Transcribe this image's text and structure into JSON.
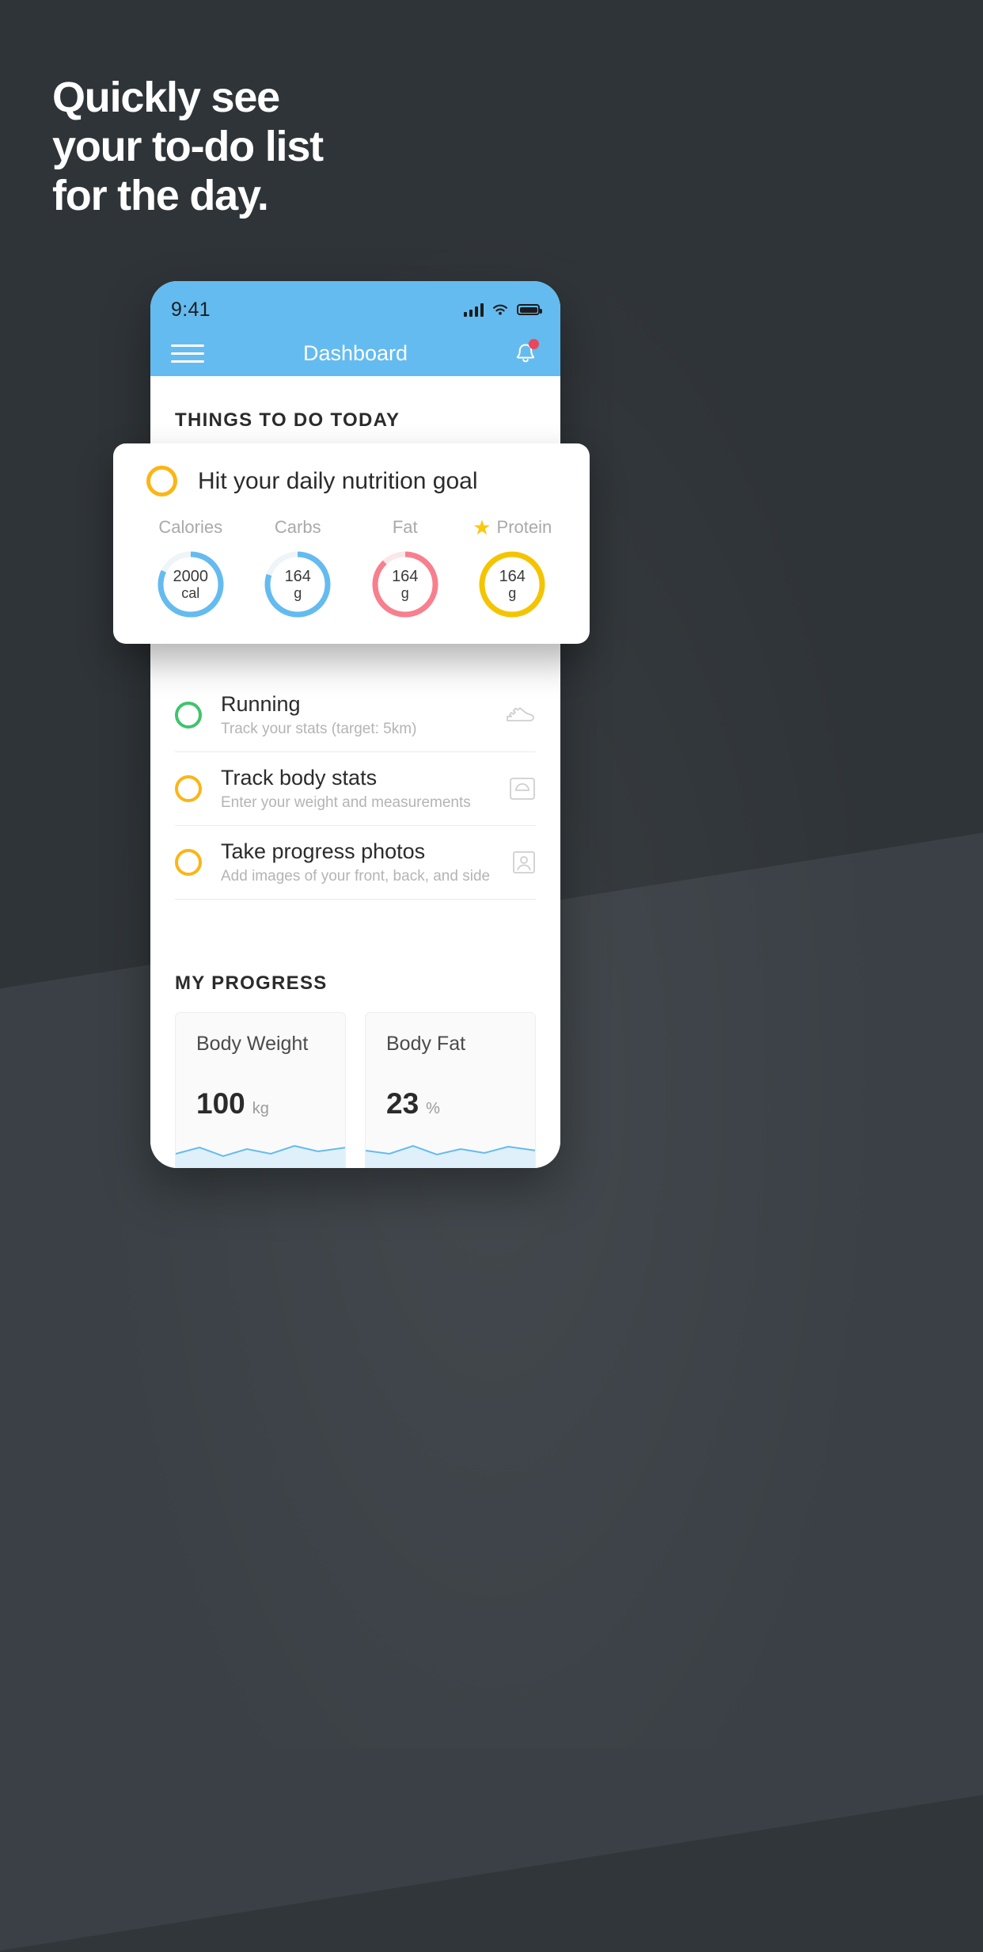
{
  "promo": {
    "headline_lines": [
      "Quickly see",
      "your to-do list",
      "for the day."
    ]
  },
  "phone": {
    "status_bar": {
      "time": "9:41",
      "signal_icon": "cellular-signal-icon",
      "wifi_icon": "wifi-icon",
      "battery_icon": "battery-full-icon"
    },
    "nav": {
      "menu_icon": "hamburger-menu-icon",
      "title": "Dashboard",
      "notification_icon": "bell-icon",
      "notification_badge": ""
    },
    "sections": {
      "todo_title": "THINGS TO DO TODAY",
      "progress_title": "MY PROGRESS"
    },
    "tasks": [
      {
        "title": "Running",
        "subtitle": "Track your stats (target: 5km)",
        "status_color": "#3ec46d",
        "icon": "running-shoe-icon"
      },
      {
        "title": "Track body stats",
        "subtitle": "Enter your weight and measurements",
        "status_color": "#fbb516",
        "icon": "weight-scale-icon"
      },
      {
        "title": "Take progress photos",
        "subtitle": "Add images of your front, back, and side",
        "status_color": "#fbb516",
        "icon": "photo-person-icon"
      }
    ],
    "progress_cards": [
      {
        "label": "Body Weight",
        "value": "100",
        "unit": "kg"
      },
      {
        "label": "Body Fat",
        "value": "23",
        "unit": "%"
      }
    ]
  },
  "nutrition_card": {
    "status_color": "#fbb516",
    "title": "Hit your daily nutrition goal",
    "macros": [
      {
        "label": "Calories",
        "value": "2000",
        "unit": "cal",
        "color": "#64bbef",
        "starred": false,
        "percent": 82
      },
      {
        "label": "Carbs",
        "value": "164",
        "unit": "g",
        "color": "#64bbef",
        "starred": false,
        "percent": 80
      },
      {
        "label": "Fat",
        "value": "164",
        "unit": "g",
        "color": "#f87f8e",
        "starred": false,
        "percent": 88
      },
      {
        "label": "Protein",
        "value": "164",
        "unit": "g",
        "color": "#f5c400",
        "starred": true,
        "percent": 100
      }
    ]
  },
  "theme": {
    "background": "#2f3438",
    "accent_blue": "#64bbef",
    "amber": "#fbb516",
    "green": "#3ec46d",
    "red": "#f87f8e"
  }
}
